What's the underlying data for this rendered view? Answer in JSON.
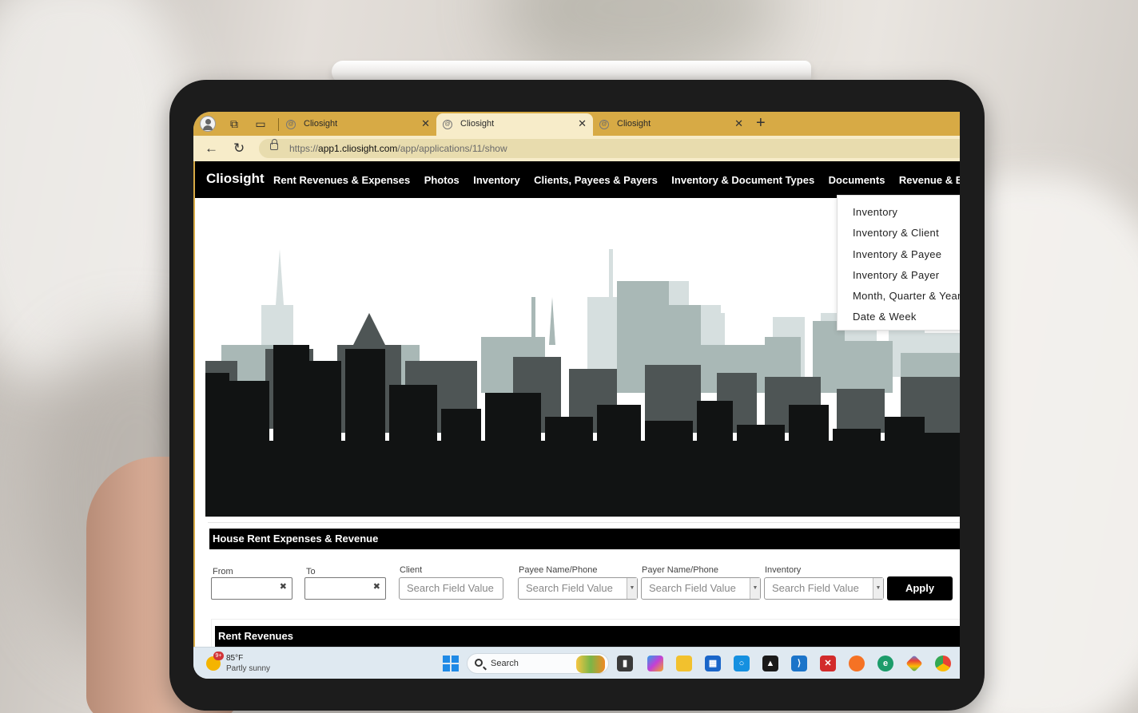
{
  "browser": {
    "tabs": [
      {
        "title": "Cliosight",
        "active": false
      },
      {
        "title": "Cliosight",
        "active": true
      },
      {
        "title": "Cliosight",
        "active": false
      }
    ],
    "url_prefix": "https://",
    "url_host": "app1.cliosight.com",
    "url_path": "/app/applications/11/show"
  },
  "app": {
    "brand": "Cliosight",
    "menu": [
      "Rent Revenues & Expenses",
      "Photos",
      "Inventory",
      "Clients, Payees & Payers",
      "Inventory & Document Types",
      "Documents",
      "Revenue & Expenses Sum"
    ],
    "dropdown": [
      "Inventory",
      "Inventory & Client",
      "Inventory & Payee",
      "Inventory & Payer",
      "Month, Quarter & Year",
      "Date & Week"
    ]
  },
  "filters": {
    "panel_title": "House Rent Expenses & Revenue",
    "from_label": "From",
    "to_label": "To",
    "client_label": "Client",
    "payee_label": "Payee Name/Phone",
    "payer_label": "Payer Name/Phone",
    "inventory_label": "Inventory",
    "search_placeholder": "Search Field Value",
    "apply_label": "Apply",
    "subpanel_title": "Rent Revenues"
  },
  "taskbar": {
    "weather_badge": "9+",
    "temperature": "85°F",
    "condition": "Partly sunny",
    "search_label": "Search"
  }
}
